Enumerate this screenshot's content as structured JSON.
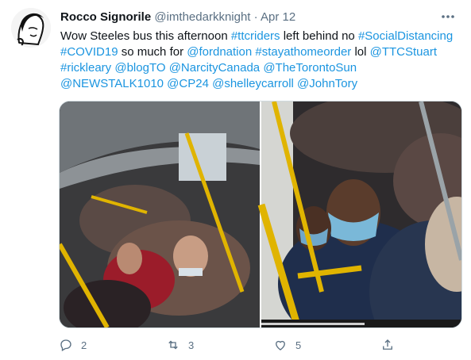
{
  "tweet": {
    "name": "Rocco Signorile",
    "handle": "@imthedarkknight",
    "separator": "·",
    "date": "Apr 12",
    "text_segments": [
      {
        "t": "Wow Steeles bus this afternoon ",
        "link": false
      },
      {
        "t": "#ttcriders",
        "link": true
      },
      {
        "t": " left behind no ",
        "link": false
      },
      {
        "t": "#SocialDistancing",
        "link": true
      },
      {
        "t": " ",
        "link": false
      },
      {
        "t": "#COVID19",
        "link": true
      },
      {
        "t": " so much for ",
        "link": false
      },
      {
        "t": "@fordnation",
        "link": true
      },
      {
        "t": " ",
        "link": false
      },
      {
        "t": "#stayathomeorder",
        "link": true
      },
      {
        "t": " lol ",
        "link": false
      },
      {
        "t": "@TTCStuart",
        "link": true
      },
      {
        "t": " ",
        "link": false
      },
      {
        "t": "#rickleary",
        "link": true
      },
      {
        "t": " ",
        "link": false
      },
      {
        "t": "@blogTO",
        "link": true
      },
      {
        "t": " ",
        "link": false
      },
      {
        "t": "@NarcityCanada",
        "link": true
      },
      {
        "t": " ",
        "link": false
      },
      {
        "t": "@TheTorontoSun",
        "link": true
      },
      {
        "t": " ",
        "link": false
      },
      {
        "t": "@NEWSTALK1010",
        "link": true
      },
      {
        "t": " ",
        "link": false
      },
      {
        "t": "@CP24",
        "link": true
      },
      {
        "t": " ",
        "link": false
      },
      {
        "t": "@shelleycarroll",
        "link": true
      },
      {
        "t": " ",
        "link": false
      },
      {
        "t": "@JohnTory",
        "link": true
      }
    ]
  },
  "actions": {
    "reply_count": "2",
    "retweet_count": "3",
    "like_count": "5"
  },
  "icons": {
    "more": "more-icon",
    "reply": "reply-icon",
    "retweet": "retweet-icon",
    "like": "like-icon",
    "share": "share-icon"
  },
  "colors": {
    "link": "#1b95e0",
    "muted": "#5b7083",
    "text": "#0f1419",
    "rail_yellow": "#e0b400"
  }
}
